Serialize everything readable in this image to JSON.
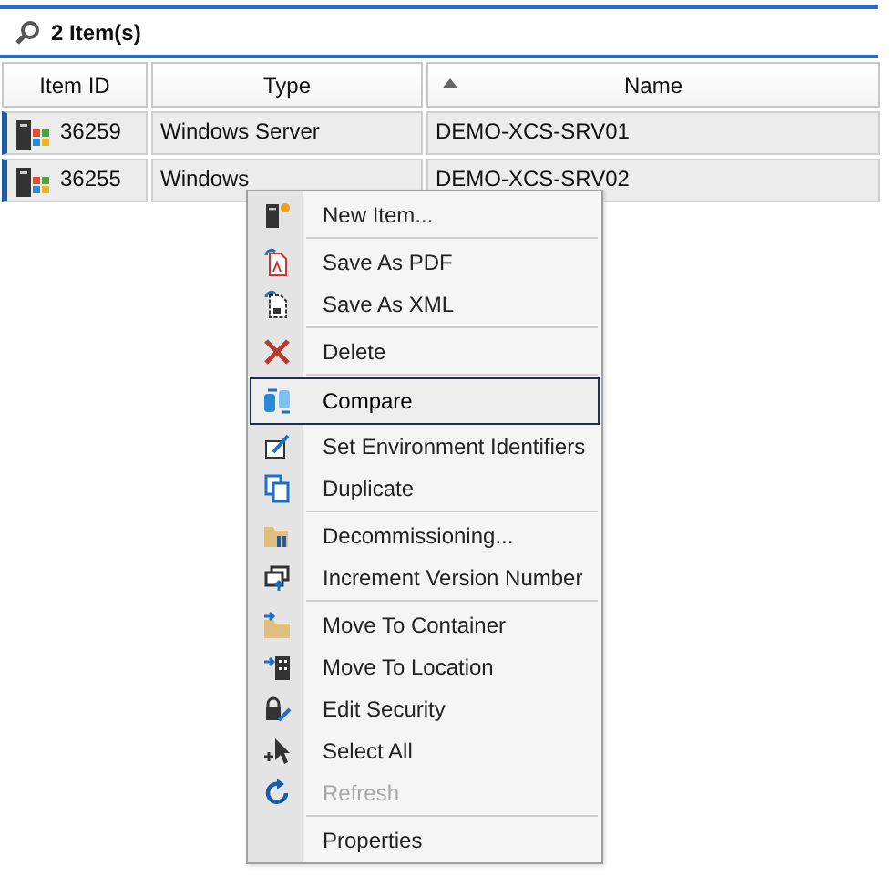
{
  "header": {
    "count": "2 Item(s)"
  },
  "table": {
    "columns": [
      {
        "label": "Item ID",
        "sorted": false
      },
      {
        "label": "Type",
        "sorted": false
      },
      {
        "label": "Name",
        "sorted": true
      }
    ],
    "rows": [
      {
        "cells": [
          "36259",
          "Windows Server",
          "DEMO-XCS-SRV01"
        ]
      },
      {
        "cells": [
          "36255",
          "Windows",
          "DEMO-XCS-SRV02"
        ]
      }
    ]
  },
  "context_menu": {
    "groups": [
      [
        {
          "label": "New Item...",
          "disabled": false,
          "selected": false
        }
      ],
      [
        {
          "label": "Save As PDF",
          "disabled": false,
          "selected": false
        },
        {
          "label": "Save As XML",
          "disabled": false,
          "selected": false
        }
      ],
      [
        {
          "label": "Delete",
          "disabled": false,
          "selected": false
        }
      ],
      [
        {
          "label": "Compare",
          "disabled": false,
          "selected": true
        },
        {
          "label": "Set Environment Identifiers",
          "disabled": false,
          "selected": false
        },
        {
          "label": "Duplicate",
          "disabled": false,
          "selected": false
        }
      ],
      [
        {
          "label": "Decommissioning...",
          "disabled": false,
          "selected": false
        },
        {
          "label": "Increment Version Number",
          "disabled": false,
          "selected": false
        }
      ],
      [
        {
          "label": "Move To Container",
          "disabled": false,
          "selected": false
        },
        {
          "label": "Move To Location",
          "disabled": false,
          "selected": false
        },
        {
          "label": "Edit Security",
          "disabled": false,
          "selected": false
        },
        {
          "label": "Select All",
          "disabled": false,
          "selected": false
        },
        {
          "label": "Refresh",
          "disabled": true,
          "selected": false
        }
      ],
      [
        {
          "label": "Properties",
          "disabled": false,
          "selected": false
        }
      ]
    ]
  }
}
